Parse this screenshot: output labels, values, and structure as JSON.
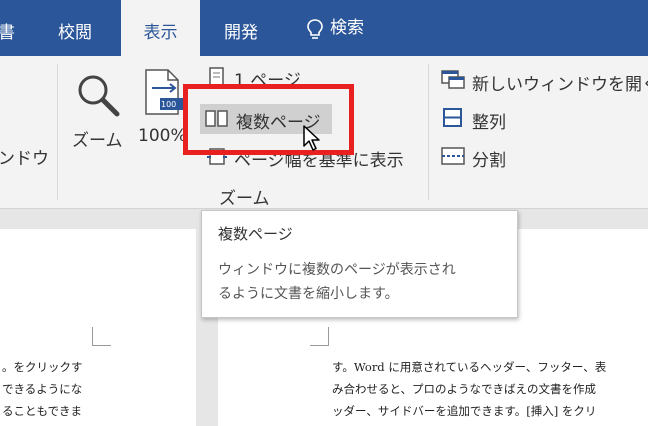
{
  "tabs": {
    "doc_fragment": "書",
    "review": "校閲",
    "view": "表示",
    "developer": "開発",
    "search": "検索"
  },
  "ribbon": {
    "window_fragment": "ンドウ",
    "zoom_button": "ズーム",
    "hundred_percent": "100%",
    "hundred_icon_text": "100",
    "one_page": "1 ページ",
    "multiple_pages": "複数ページ",
    "page_width": "ページ幅を基準に表示",
    "zoom_group": "ズーム",
    "new_window": "新しいウィンドウを開く",
    "arrange_all": "整列",
    "split": "分割"
  },
  "tooltip": {
    "title": "複数ページ",
    "line1": "ウィンドウに複数のページが表示され",
    "line2": "るように文書を縮小します。"
  },
  "document": {
    "left_lines": [
      "。をクリックす",
      "できるようにな",
      "ることもできま"
    ],
    "right_lines": [
      "す。Word に用意されているヘッダー、フッター、表",
      "み合わせると、プロのようなできばえの文書を作成",
      "ッダー、サイドバーを追加できます。[挿入] をクリ"
    ]
  },
  "colors": {
    "tab_bar": "#2b579a",
    "ribbon_bg": "#f3f3f3",
    "highlight_border": "#e8201f",
    "hover_bg": "#d0d0d0"
  },
  "icons": [
    "lightbulb-icon",
    "magnifier-icon",
    "page-100-icon",
    "one-page-icon",
    "multiple-pages-icon",
    "page-width-icon",
    "new-window-icon",
    "arrange-all-icon",
    "split-icon",
    "mouse-cursor-icon"
  ]
}
